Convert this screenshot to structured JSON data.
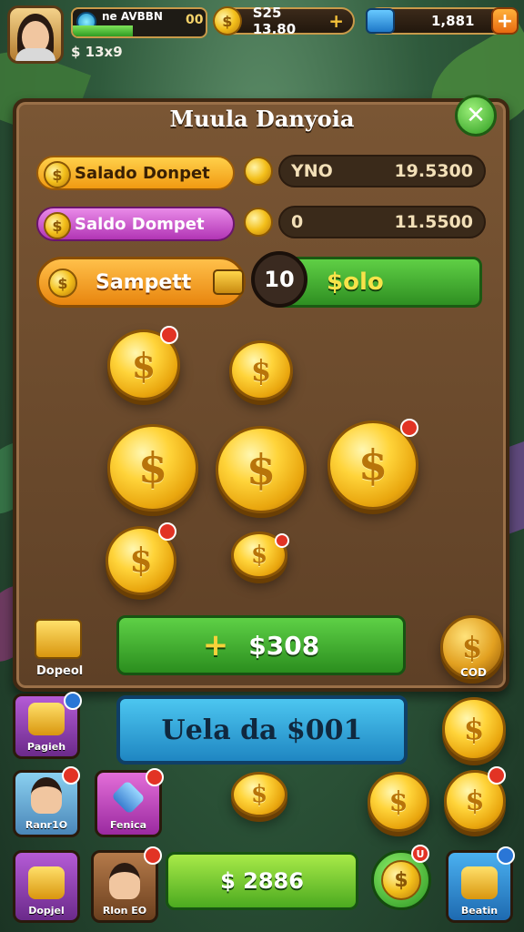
{
  "hud": {
    "level_label": "ne AVBBN",
    "level_value": "00",
    "level_progress": 0.45,
    "subtext": "$ 13x9",
    "coins": {
      "symbol": "$",
      "label": "S25 13.80",
      "plus": "+"
    },
    "gems": {
      "value": "1,881",
      "plus": "+"
    }
  },
  "panel": {
    "title": "Muula Danyoia",
    "close": "✕",
    "rows": [
      {
        "button": "Salado Donpet",
        "icon": "$",
        "value_left": "YNO",
        "value_right": "19.5300",
        "color": "#f6a51f"
      },
      {
        "button": "Saldo Dompet",
        "icon": "$",
        "value_left": "0",
        "value_right": "11.5500",
        "color": "#cf4fd1"
      }
    ],
    "sampett": {
      "button": "Sampett",
      "icon": "$",
      "badge": "10",
      "right_label": "$olo"
    },
    "coins": {
      "symbol": "$"
    },
    "deposit": {
      "label": "Dopeol"
    },
    "add_button": {
      "plus": "+",
      "amount": "$308"
    },
    "corner_coin": {
      "symbol": "$",
      "label": "COD"
    }
  },
  "claim_button": {
    "label": "Uela da $001"
  },
  "bottom": {
    "tiles_left": [
      {
        "label": "Pagieh",
        "badge": ""
      },
      {
        "label": "Ranr1O",
        "badge": ""
      },
      {
        "label": "Dopjel",
        "badge": ""
      }
    ],
    "tiles_mid": [
      {
        "label": "Fenica",
        "badge": ""
      },
      {
        "label": "Rlon EO",
        "badge": ""
      }
    ],
    "green_button": "$ 2886",
    "round_coin": "$",
    "round_badge": "U",
    "shop_tile": {
      "label": "Beatin"
    },
    "coin_symbol": "$"
  }
}
